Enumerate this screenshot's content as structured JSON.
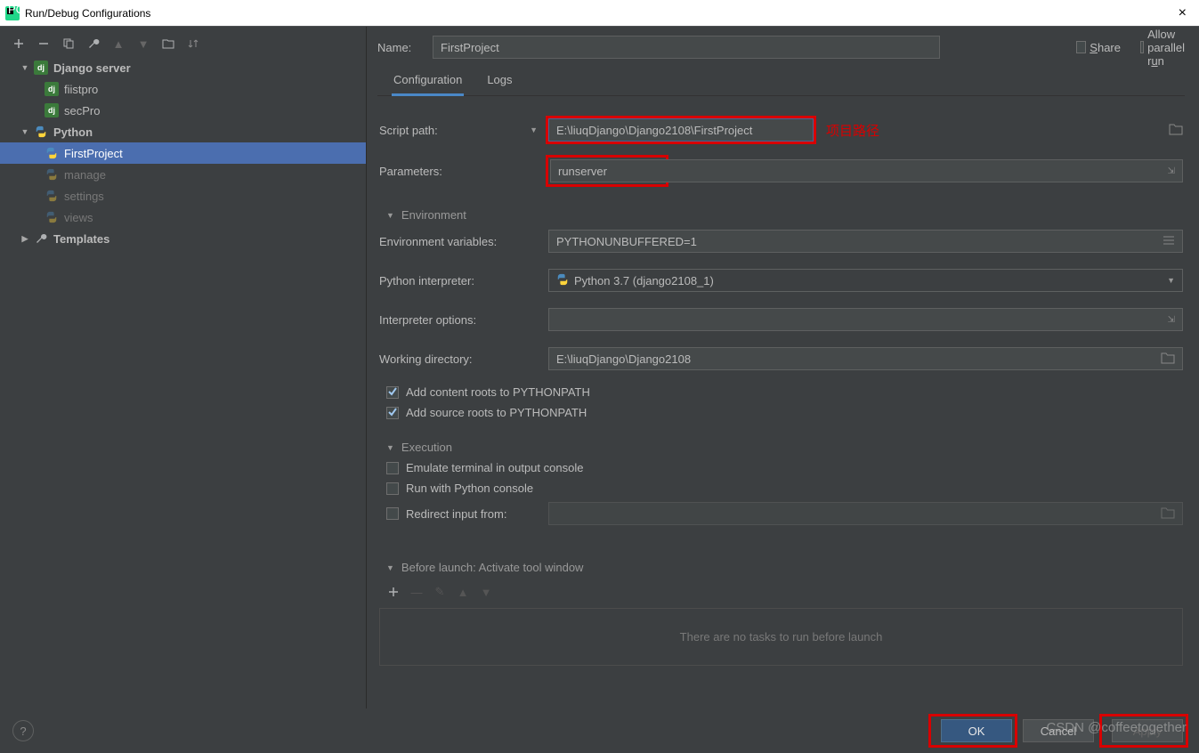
{
  "window": {
    "title": "Run/Debug Configurations"
  },
  "tree": {
    "django_server": {
      "label": "Django server",
      "children": [
        {
          "label": "fiistpro"
        },
        {
          "label": "secPro"
        }
      ]
    },
    "python": {
      "label": "Python",
      "children": [
        {
          "label": "FirstProject",
          "selected": true
        },
        {
          "label": "manage",
          "dim": true
        },
        {
          "label": "settings",
          "dim": true
        },
        {
          "label": "views",
          "dim": true
        }
      ]
    },
    "templates": {
      "label": "Templates"
    }
  },
  "header": {
    "name_label": "Name:",
    "name_value": "FirstProject",
    "share_label": "Share",
    "allow_parallel_label": "Allow parallel run"
  },
  "tabs": {
    "configuration": "Configuration",
    "logs": "Logs"
  },
  "form": {
    "script_path_label": "Script path:",
    "script_path_value": "E:\\liuqDjango\\Django2108\\FirstProject",
    "annotation_project_path": "项目路径",
    "parameters_label": "Parameters:",
    "parameters_value": "runserver",
    "env_section": "Environment",
    "env_vars_label": "Environment variables:",
    "env_vars_value": "PYTHONUNBUFFERED=1",
    "interpreter_label": "Python interpreter:",
    "interpreter_value": "Python 3.7 (django2108_1)",
    "interp_options_label": "Interpreter options:",
    "interp_options_value": "",
    "working_dir_label": "Working directory:",
    "working_dir_value": "E:\\liuqDjango\\Django2108",
    "add_content_roots": "Add content roots to PYTHONPATH",
    "add_source_roots": "Add source roots to PYTHONPATH",
    "exec_section": "Execution",
    "emulate_terminal": "Emulate terminal in output console",
    "run_python_console": "Run with Python console",
    "redirect_input": "Redirect input from:",
    "before_launch_section": "Before launch: Activate tool window",
    "no_tasks": "There are no tasks to run before launch"
  },
  "buttons": {
    "ok": "OK",
    "cancel": "Cancel",
    "apply": "Apply"
  },
  "watermark": "CSDN @coffeetogether"
}
